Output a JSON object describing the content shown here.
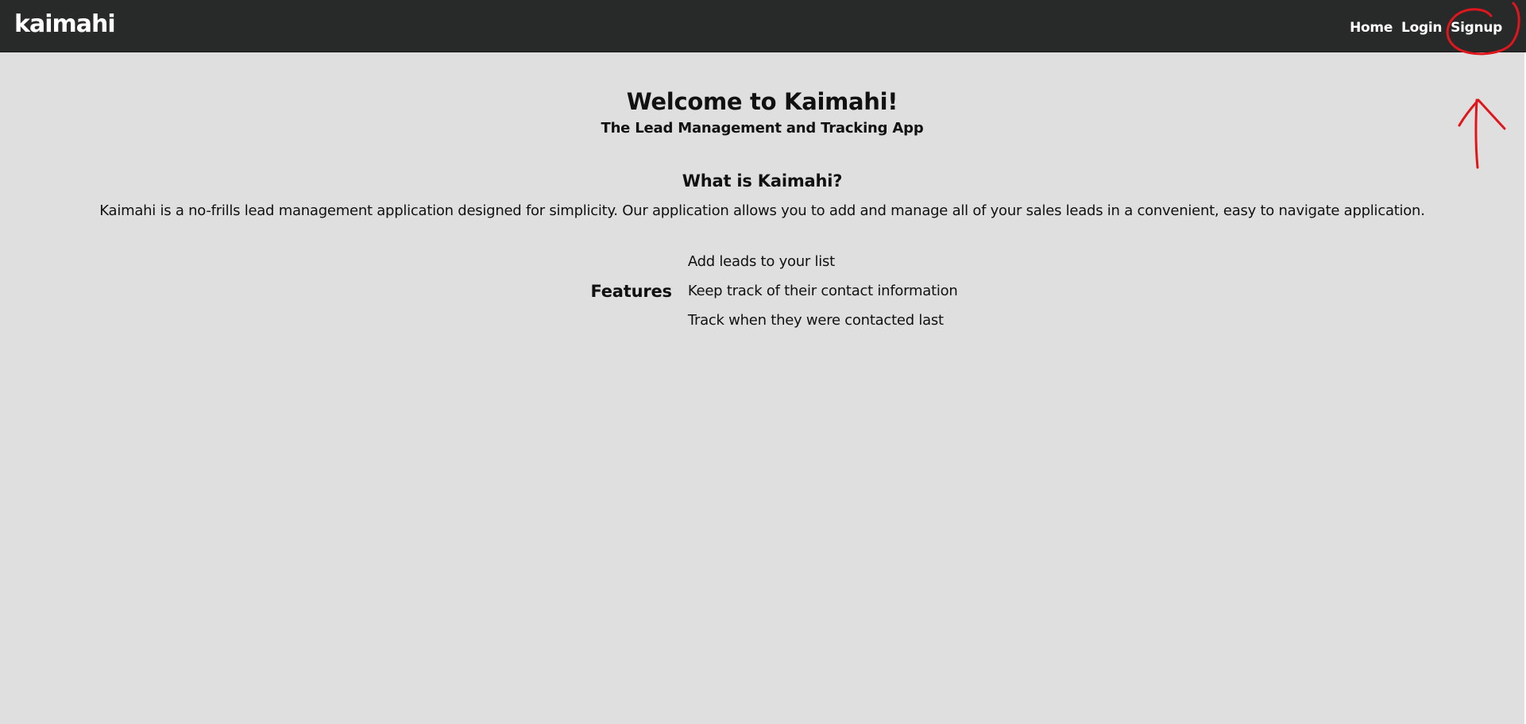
{
  "navbar": {
    "brand": "kaimahi",
    "links": [
      {
        "label": "Home"
      },
      {
        "label": "Login"
      },
      {
        "label": "Signup"
      }
    ]
  },
  "main": {
    "title": "Welcome to Kaimahi!",
    "subtitle": "The Lead Management and Tracking App",
    "about_heading": "What is Kaimahi?",
    "about_text": "Kaimahi is a no-frills lead management application designed for simplicity. Our application allows you to add and manage all of your sales leads in a convenient, easy to navigate application.",
    "features_label": "Features",
    "features": [
      "Add leads to your list",
      "Keep track of their contact information",
      "Track when they were contacted last"
    ]
  },
  "colors": {
    "navbar_bg": "#282a29",
    "page_bg": "#dfdfdf",
    "annotation_red": "#e0161d"
  }
}
